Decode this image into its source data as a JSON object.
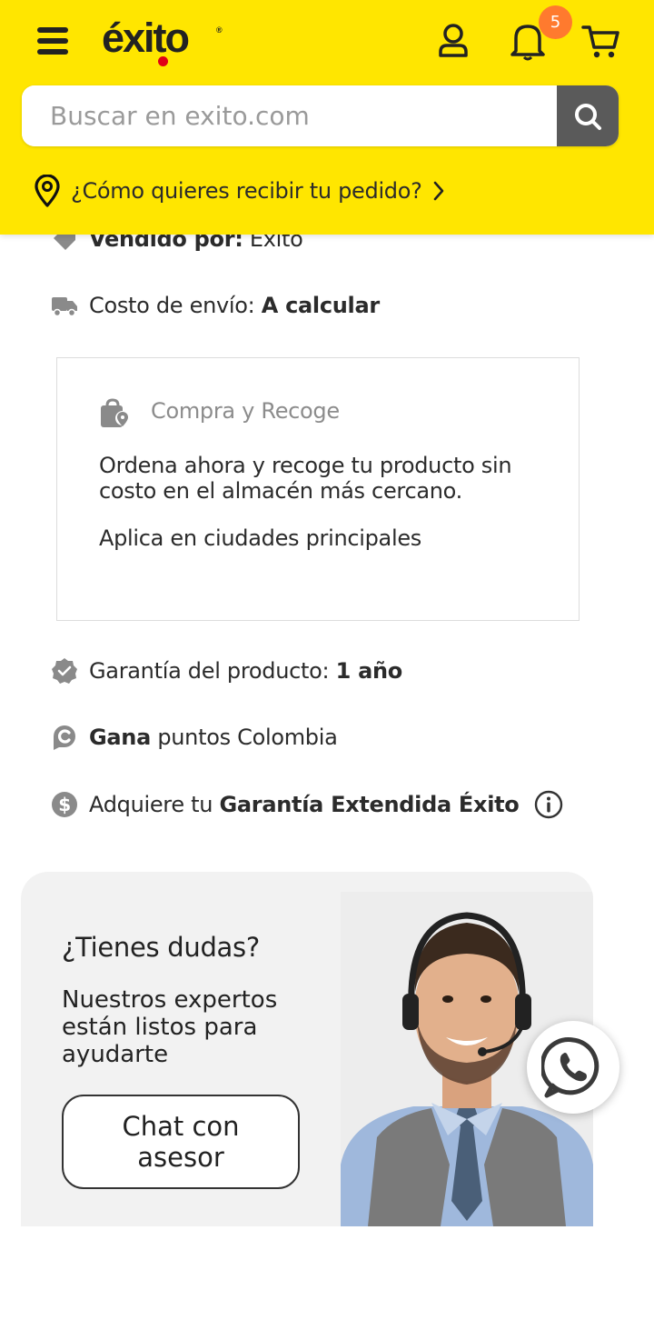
{
  "header": {
    "logo_text": "éxito",
    "logo_reg": "®",
    "notification_count": "5",
    "brand_color": "#ffe600",
    "badge_color": "#ff7a2e",
    "search": {
      "placeholder": "Buscar en exito.com",
      "value": ""
    },
    "delivery_prompt": "¿Cómo quieres recibir tu pedido?",
    "icons": [
      "menu-icon",
      "user-icon",
      "bell-icon",
      "cart-icon",
      "search-icon",
      "location-pin-icon",
      "chevron-right-icon"
    ]
  },
  "info": {
    "seller_label": "Vendido por:",
    "seller_value": "Exito",
    "shipping_label": "Costo de envío:",
    "shipping_value": "A calcular",
    "warranty_label": "Garantía del producto:",
    "warranty_value": "1 año",
    "points_bold": "Gana",
    "points_text": "puntos Colombia",
    "extended_prefix": "Adquiere tu",
    "extended_bold": "Garantía Extendida Éxito"
  },
  "pickup": {
    "title": "Compra y Recoge",
    "description": "Ordena ahora y recoge tu producto sin costo en el almacén más cercano.",
    "note": "Aplica en ciudades principales"
  },
  "help": {
    "title": "¿Tienes dudas?",
    "description": "Nuestros expertos están listos para ayudarte",
    "button_label": "Chat con asesor"
  }
}
